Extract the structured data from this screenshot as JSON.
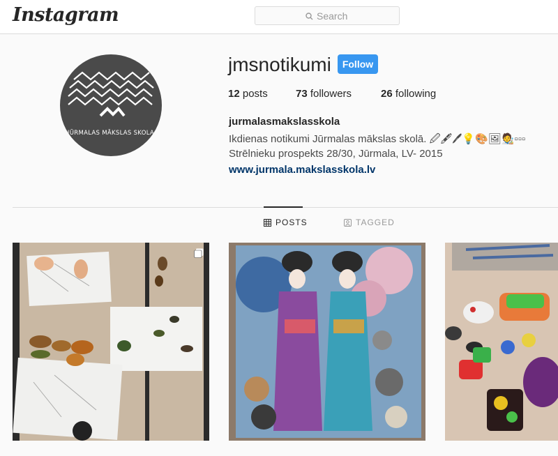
{
  "header": {
    "logo": "Instagram",
    "search": {
      "placeholder": "Search"
    }
  },
  "profile": {
    "username": "jmsnotikumi",
    "follow_label": "Follow",
    "stats": [
      {
        "count": "12",
        "label": "posts"
      },
      {
        "count": "73",
        "label": "followers"
      },
      {
        "count": "26",
        "label": "following"
      }
    ],
    "full_name": "jurmalasmakslasskola",
    "bio_line1": "Ikdienas notikumi Jūrmalas mākslas skolā. 🖉🖋🖊💡🎨🖼🧑‍🎨▫▫▫",
    "bio_line2": "Strēlnieku prospekts 28/30, Jūrmala, LV- 2015",
    "website": "www.jurmala.makslasskola.lv",
    "avatar_text": "JŪRMALAS MĀKSLAS SKOLA"
  },
  "tabs": [
    {
      "label": "POSTS",
      "icon": "grid-icon",
      "active": true
    },
    {
      "label": "TAGGED",
      "icon": "tag-person-icon",
      "active": false
    }
  ],
  "posts": [
    {
      "name": "leaf-collage-post",
      "multiple": true
    },
    {
      "name": "geisha-drawing-post",
      "multiple": false
    },
    {
      "name": "clay-sculptures-post",
      "multiple": false
    }
  ],
  "colors": {
    "accent": "#3897f0",
    "link": "#003569",
    "border": "#dbdbdb",
    "background": "#fafafa"
  }
}
